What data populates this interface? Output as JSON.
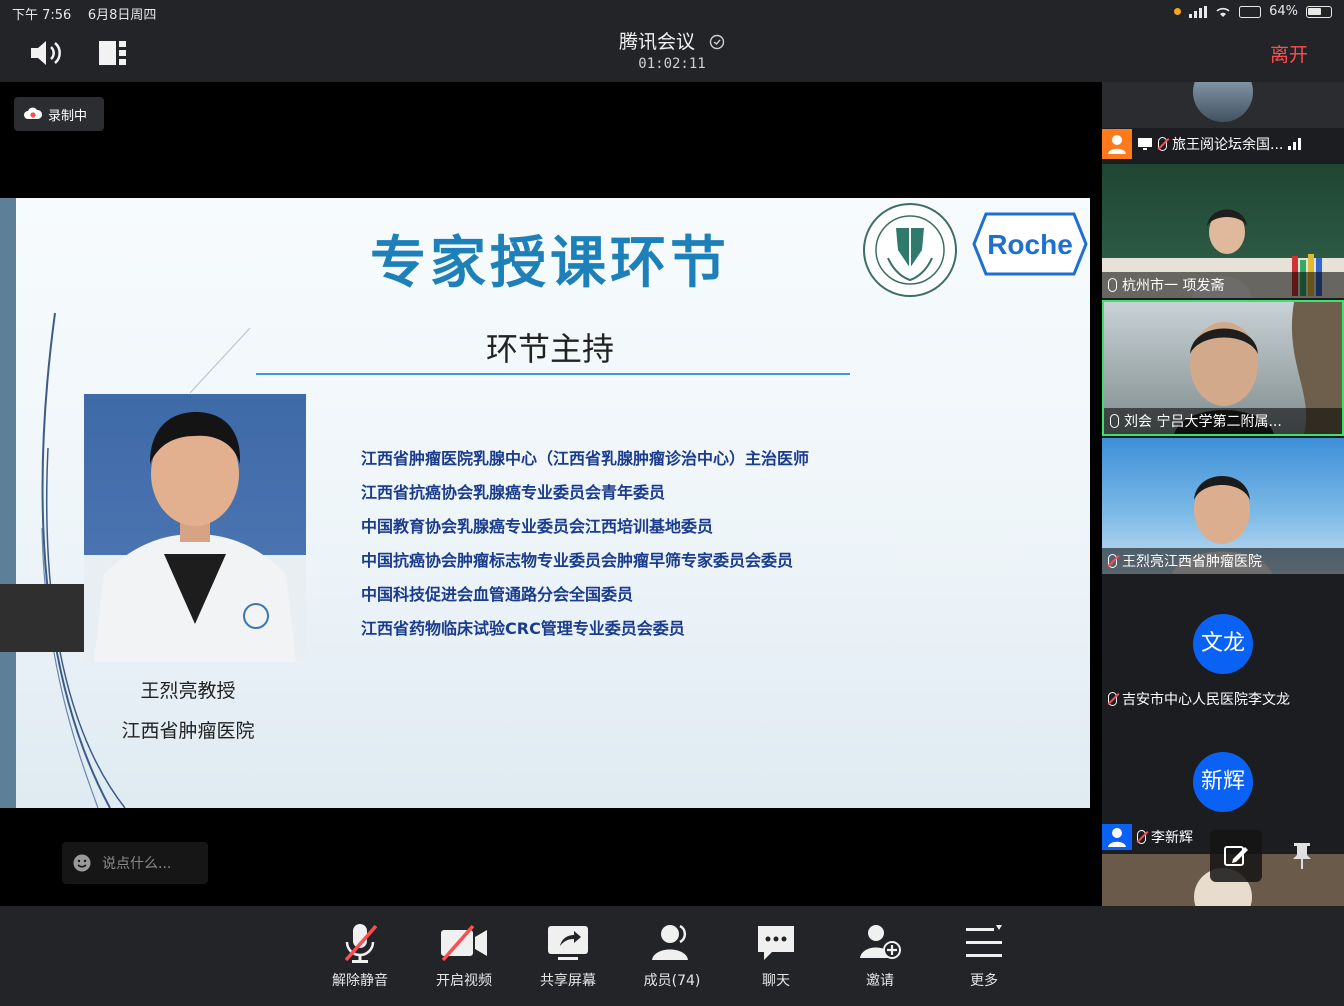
{
  "status_bar": {
    "time": "下午 7:56",
    "date": "6月8日周四",
    "battery": "64%",
    "battery_level": 0.64
  },
  "header": {
    "title": "腾讯会议",
    "duration": "01:02:11",
    "leave_label": "离开"
  },
  "main": {
    "recording_label": "录制中",
    "chat_placeholder": "说点什么..."
  },
  "slide": {
    "title": "专家授课环节",
    "subtitle": "环节主持",
    "logo_text": "Roche",
    "speaker_name": "王烈亮教授",
    "speaker_institution": "江西省肿瘤医院",
    "qualifications": [
      "江西省肿瘤医院乳腺中心（江西省乳腺肿瘤诊治中心）主治医师",
      "江西省抗癌协会乳腺癌专业委员会青年委员",
      "中国教育协会乳腺癌专业委员会江西培训基地委员",
      "中国抗癌协会肿瘤标志物专业委员会肿瘤早筛专家委员会委员",
      "中国科技促进会血管通路分会全国委员",
      "江西省药物临床试验CRC管理专业委员会委员"
    ]
  },
  "participants": [
    {
      "name": "旅王阅论坛余国...",
      "kind": "screen-share"
    },
    {
      "name": "杭州市一 项发斋",
      "kind": "video"
    },
    {
      "name": "刘会 宁吕大学第二附属...",
      "kind": "video"
    },
    {
      "name": "王烈亮江西省肿瘤医院",
      "kind": "video"
    },
    {
      "name": "吉安市中心人民医院李文龙",
      "kind": "avatar",
      "avatar": "文龙",
      "avatar_color": "#0a62f5"
    },
    {
      "name": "李新辉",
      "kind": "avatar",
      "avatar": "新辉",
      "avatar_color": "#0a62f5"
    }
  ],
  "toolbar": {
    "items": [
      {
        "label": "解除静音",
        "icon": "mic-off-icon"
      },
      {
        "label": "开启视频",
        "icon": "camera-off-icon"
      },
      {
        "label": "共享屏幕",
        "icon": "share-screen-icon"
      },
      {
        "label": "成员(74)",
        "icon": "members-icon"
      },
      {
        "label": "聊天",
        "icon": "chat-icon"
      },
      {
        "label": "邀请",
        "icon": "invite-icon"
      },
      {
        "label": "更多",
        "icon": "more-icon"
      }
    ]
  },
  "colors": {
    "accent_blue": "#0a62f5",
    "leave_red": "#ff4d4f",
    "slide_title_blue": "#1e80b8",
    "qualification_blue": "#1b3c8c"
  }
}
